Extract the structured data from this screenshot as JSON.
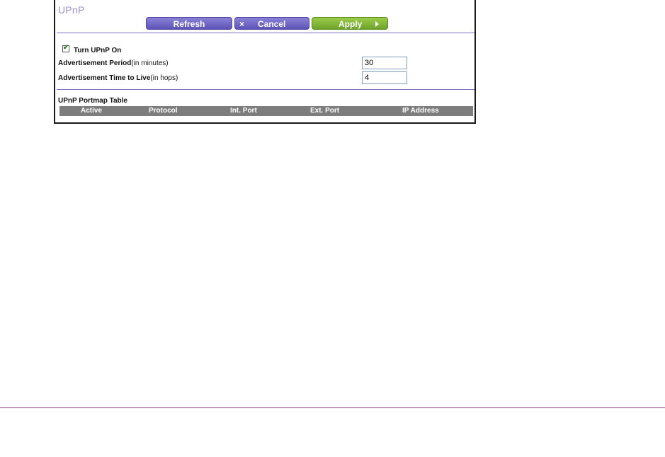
{
  "panel": {
    "title": "UPnP",
    "buttons": {
      "refresh": "Refresh",
      "cancel_icon": "×",
      "cancel": "Cancel",
      "apply": "Apply"
    },
    "turn_on": {
      "label": "Turn UPnP On",
      "checked": true,
      "check_glyph": "✔"
    },
    "adv_period": {
      "label_bold": "Advertisement Period",
      "label_rest": "(in minutes)",
      "value": "30"
    },
    "adv_ttl": {
      "label_bold": "Advertisement Time to Live",
      "label_rest": "(in hops)",
      "value": "4"
    },
    "portmap": {
      "title": "UPnP Portmap Table",
      "columns": [
        "Active",
        "Protocol",
        "Int. Port",
        "Ext. Port",
        "IP Address"
      ]
    }
  },
  "colors": {
    "title": "#9b92d6",
    "purple_button": "#5d53b6",
    "green_button": "#6ea32a",
    "table_header": "#7d7d7d",
    "footer_rule": "#8b3a8b"
  }
}
